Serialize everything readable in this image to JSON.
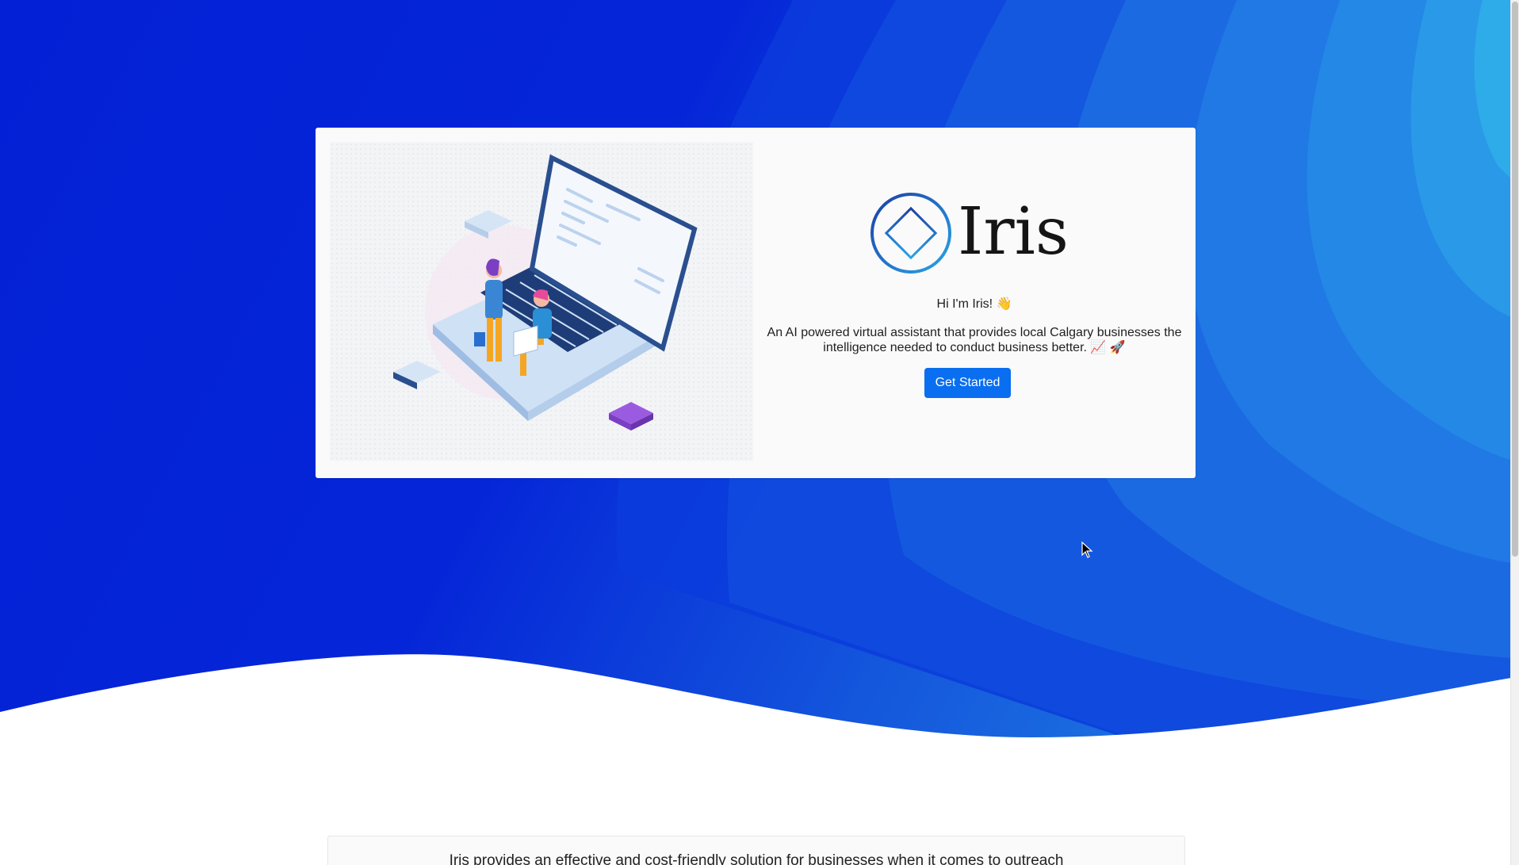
{
  "hero": {
    "bg_color_dark": "#0420d6",
    "bg_color_light": "#2bb0ea"
  },
  "brand": {
    "name": "Iris",
    "logo_icon": "diamond-in-circle-icon",
    "logo_color": "#1e5fc8"
  },
  "intro": {
    "greeting": "Hi I'm Iris! 👋",
    "description": "An AI powered virtual assistant that provides local Calgary businesses the intelligence needed to conduct business better. 📈 🚀",
    "cta_label": "Get Started",
    "cta_color": "#0a6ef0"
  },
  "illustration": {
    "icon": "people-with-laptop-illustration"
  },
  "info": {
    "text": "Iris provides an effective and cost-friendly solution for businesses when it comes to outreach"
  },
  "cursor": {
    "icon": "mouse-pointer-icon"
  }
}
